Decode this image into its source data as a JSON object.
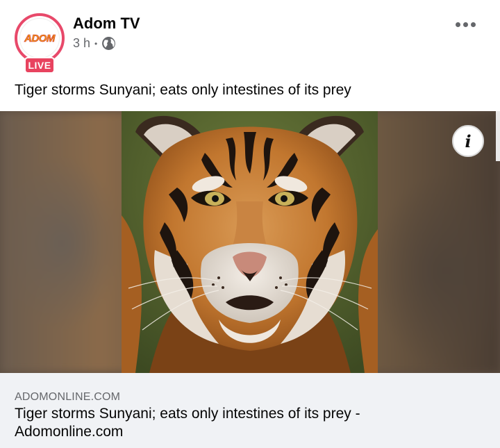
{
  "post": {
    "page_name": "Adom TV",
    "timestamp": "3 h",
    "separator": "•",
    "audience_icon": "globe-icon",
    "live_badge": "LIVE",
    "avatar_logo_text": "ADOM",
    "text": "Tiger storms Sunyani; eats only intestines of its prey",
    "more_icon": "more-horizontal-icon"
  },
  "media": {
    "subject": "tiger",
    "info_icon": "info-icon",
    "info_glyph": "i"
  },
  "link": {
    "domain": "ADOMONLINE.COM",
    "title": "Tiger storms Sunyani; eats only intestines of its prey - Adomonline.com"
  },
  "colors": {
    "live_badge": "#e8435f",
    "avatar_ring": "#e8496a",
    "link_card_bg": "#f0f2f5",
    "secondary_text": "#65676b"
  }
}
